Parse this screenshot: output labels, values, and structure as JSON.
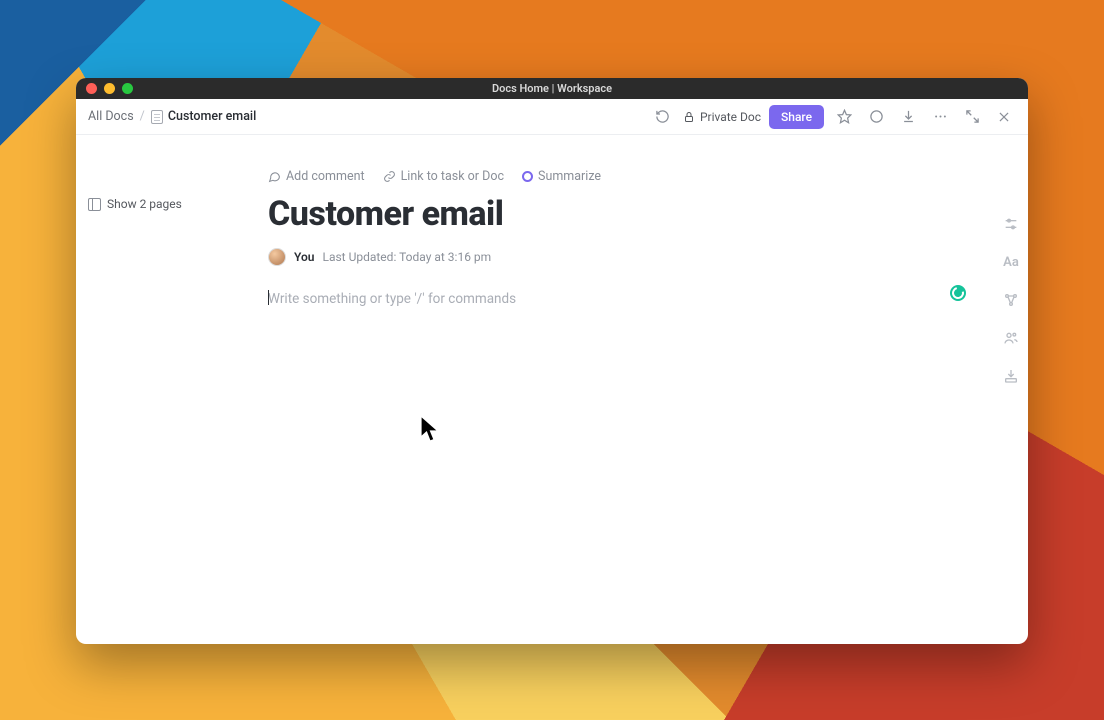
{
  "window": {
    "title": "Docs Home | Workspace"
  },
  "breadcrumb": {
    "root": "All Docs",
    "current": "Customer email"
  },
  "toolbar": {
    "private_label": "Private Doc",
    "share_label": "Share"
  },
  "sidebar": {
    "show_pages_label": "Show 2 pages"
  },
  "actions": {
    "comment": "Add comment",
    "link": "Link to task or Doc",
    "summarize": "Summarize"
  },
  "doc": {
    "title": "Customer email",
    "author": "You",
    "updated": "Last Updated: Today at 3:16 pm",
    "placeholder": "Write something or type '/' for commands"
  }
}
